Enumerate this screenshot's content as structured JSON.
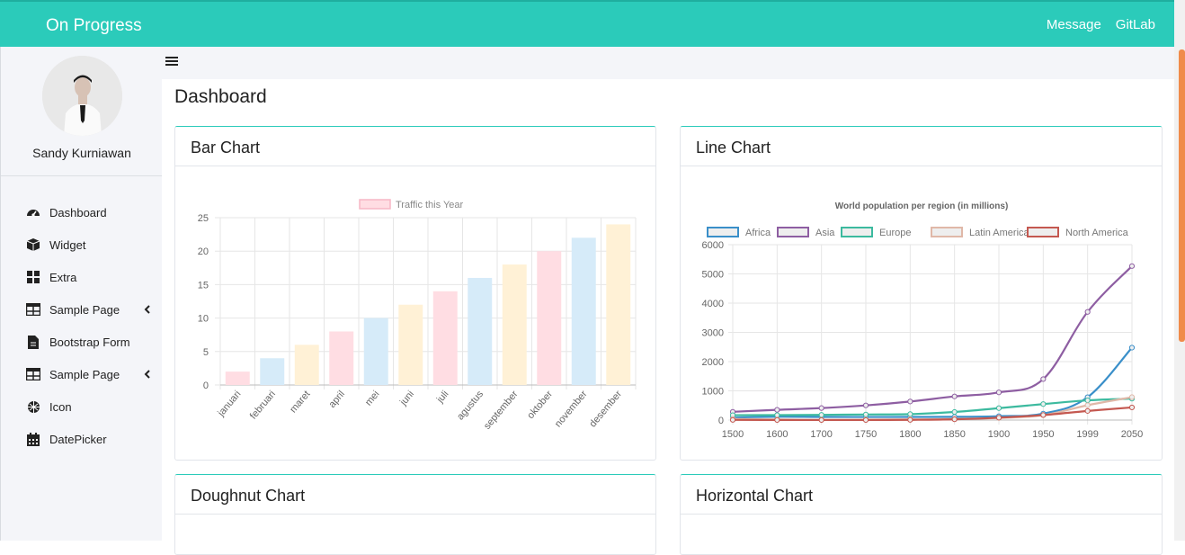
{
  "topbar": {
    "brand": "On Progress",
    "nav": [
      "Message",
      "GitLab"
    ]
  },
  "user": {
    "name": "Sandy Kurniawan"
  },
  "sidebar": {
    "items": [
      {
        "label": "Dashboard",
        "icon": "dashboard-icon"
      },
      {
        "label": "Widget",
        "icon": "cubes-icon"
      },
      {
        "label": "Extra",
        "icon": "grid-icon"
      },
      {
        "label": "Sample Page",
        "icon": "table-icon",
        "has_submenu": true
      },
      {
        "label": "Bootstrap Form",
        "icon": "file-icon"
      },
      {
        "label": "Sample Page",
        "icon": "table-icon",
        "has_submenu": true
      },
      {
        "label": "Icon",
        "icon": "globe-icon"
      },
      {
        "label": "DatePicker",
        "icon": "calendar-icon"
      }
    ]
  },
  "page": {
    "title": "Dashboard"
  },
  "cards": {
    "bar": {
      "title": "Bar Chart"
    },
    "line": {
      "title": "Line Chart"
    },
    "doughnut": {
      "title": "Doughnut Chart"
    },
    "horizontal": {
      "title": "Horizontal Chart"
    }
  },
  "colors": {
    "accent": "#2bcbba",
    "scroll_thumb": "#f08b4a"
  },
  "chart_data": [
    {
      "type": "bar",
      "legend": [
        "Traffic this Year"
      ],
      "categories": [
        "januari",
        "februari",
        "maret",
        "april",
        "mei",
        "juni",
        "juli",
        "agustus",
        "september",
        "oktober",
        "november",
        "desember"
      ],
      "values": [
        2,
        4,
        6,
        8,
        10,
        12,
        14,
        16,
        18,
        20,
        22,
        24
      ],
      "colors": [
        "#ffdde3",
        "#d6ebf9",
        "#fff1d6",
        "#ffdde3",
        "#d6ebf9",
        "#fff1d6",
        "#ffdde3",
        "#d6ebf9",
        "#fff1d6",
        "#ffdde3",
        "#d6ebf9",
        "#fff1d6"
      ],
      "ylim": [
        0,
        25
      ],
      "yticks": [
        0,
        5,
        10,
        15,
        20,
        25
      ],
      "grid": true,
      "legend_position": "top"
    },
    {
      "type": "line",
      "title": "World population per region (in millions)",
      "x": [
        "1500",
        "1600",
        "1700",
        "1750",
        "1800",
        "1850",
        "1900",
        "1950",
        "1999",
        "2050"
      ],
      "series": [
        {
          "name": "Africa",
          "color": "#3a8fc9",
          "values": [
            86,
            114,
            106,
            106,
            107,
            111,
            133,
            221,
            783,
            2478
          ]
        },
        {
          "name": "Asia",
          "color": "#8e5ea2",
          "values": [
            282,
            350,
            411,
            502,
            635,
            809,
            947,
            1402,
            3700,
            5267
          ]
        },
        {
          "name": "Europe",
          "color": "#3cba9f",
          "values": [
            168,
            170,
            178,
            190,
            203,
            276,
            408,
            547,
            675,
            734
          ]
        },
        {
          "name": "Latin America",
          "color": "#e0b8a8",
          "values": [
            40,
            20,
            10,
            16,
            24,
            38,
            74,
            167,
            508,
            784
          ]
        },
        {
          "name": "North America",
          "color": "#c45850",
          "values": [
            6,
            3,
            2,
            2,
            7,
            26,
            82,
            172,
            312,
            433
          ]
        }
      ],
      "ylim": [
        0,
        6000
      ],
      "yticks": [
        0,
        1000,
        2000,
        3000,
        4000,
        5000,
        6000
      ],
      "grid": true,
      "legend_position": "top"
    }
  ]
}
